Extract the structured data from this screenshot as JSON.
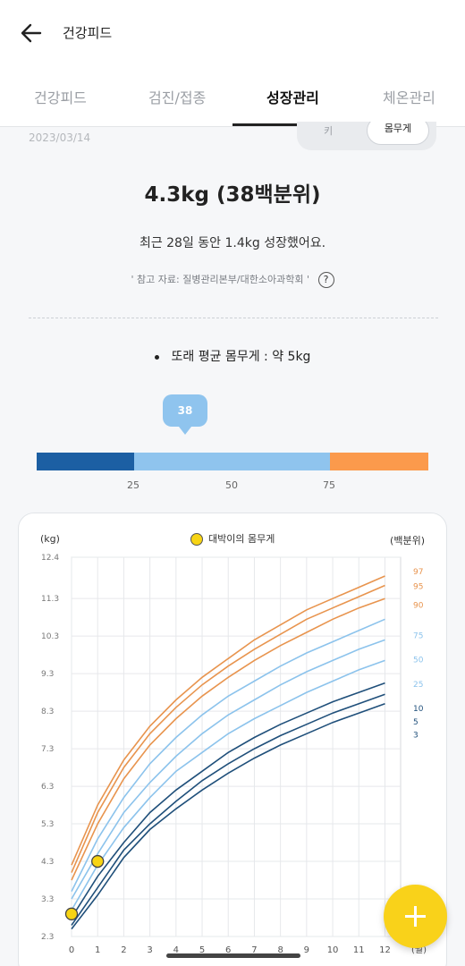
{
  "header": {
    "title": "건강피드",
    "back_icon": "arrow-left-icon"
  },
  "tabs": [
    {
      "label": "건강피드",
      "active": false
    },
    {
      "label": "검진/접종",
      "active": false
    },
    {
      "label": "성장관리",
      "active": true
    },
    {
      "label": "체온관리",
      "active": false
    }
  ],
  "date": "2023/03/14",
  "toggle": {
    "left": "키",
    "right": "몸무게",
    "selected": "몸무게"
  },
  "summary": {
    "headline": "4.3kg (38백분위)",
    "subtitle": "최근 28일 동안 1.4kg 성장했어요.",
    "reference": "' 참고 자료: 질병관리본부/대한소아과학회 '",
    "help_icon": "question-circle-icon",
    "help": "?",
    "peer_average": "또래 평균 몸무게 : 약 5kg"
  },
  "percentile": {
    "value": 38,
    "bubble": "38",
    "ticks": [
      "25",
      "50",
      "75"
    ],
    "colors": {
      "low": "#1c5fa3",
      "mid": "#8fc4ee",
      "high": "#fb9a4c"
    }
  },
  "chart_data": {
    "type": "line",
    "y_unit_label": "(kg)",
    "percentile_unit_label": "(백분위)",
    "legend": "대박이의 몸무게",
    "x_ticks": [
      "0",
      "1",
      "2",
      "3",
      "4",
      "5",
      "6",
      "7",
      "8",
      "9",
      "10",
      "11",
      "12"
    ],
    "x_unit_label": "(월)",
    "y_ticks": [
      "2.3",
      "3.3",
      "4.3",
      "5.3",
      "6.3",
      "7.3",
      "8.3",
      "9.3",
      "10.3",
      "11.3",
      "12.4"
    ],
    "ylim": [
      2.3,
      12.4
    ],
    "xlim": [
      0,
      12.6
    ],
    "months": [
      0,
      1,
      2,
      3,
      4,
      5,
      6,
      7,
      8,
      9,
      10,
      11,
      12
    ],
    "series": [
      {
        "name": "97",
        "color": "#e8944e",
        "values": [
          4.2,
          5.8,
          7.0,
          7.9,
          8.6,
          9.2,
          9.7,
          10.2,
          10.6,
          11.0,
          11.3,
          11.6,
          11.9
        ]
      },
      {
        "name": "95",
        "color": "#e8944e",
        "values": [
          4.0,
          5.6,
          6.8,
          7.7,
          8.4,
          9.0,
          9.5,
          9.95,
          10.35,
          10.75,
          11.05,
          11.35,
          11.65
        ]
      },
      {
        "name": "90",
        "color": "#e8944e",
        "values": [
          3.8,
          5.3,
          6.5,
          7.4,
          8.1,
          8.7,
          9.2,
          9.65,
          10.05,
          10.4,
          10.75,
          11.05,
          11.3
        ]
      },
      {
        "name": "75",
        "color": "#8cc3ec",
        "values": [
          3.5,
          4.9,
          6.0,
          6.9,
          7.6,
          8.2,
          8.7,
          9.1,
          9.5,
          9.85,
          10.15,
          10.45,
          10.75
        ]
      },
      {
        "name": "50",
        "color": "#8cc3ec",
        "values": [
          3.3,
          4.5,
          5.6,
          6.4,
          7.1,
          7.7,
          8.2,
          8.6,
          9.0,
          9.35,
          9.65,
          9.95,
          10.2
        ]
      },
      {
        "name": "25",
        "color": "#8cc3ec",
        "values": [
          3.0,
          4.2,
          5.2,
          6.0,
          6.7,
          7.2,
          7.7,
          8.1,
          8.45,
          8.8,
          9.1,
          9.4,
          9.65
        ]
      },
      {
        "name": "10",
        "color": "#1f4f7a",
        "values": [
          2.8,
          3.9,
          4.8,
          5.6,
          6.2,
          6.7,
          7.2,
          7.6,
          7.95,
          8.25,
          8.55,
          8.8,
          9.05
        ]
      },
      {
        "name": "5",
        "color": "#1f4f7a",
        "values": [
          2.6,
          3.6,
          4.6,
          5.3,
          5.9,
          6.45,
          6.9,
          7.3,
          7.65,
          7.95,
          8.25,
          8.5,
          8.75
        ]
      },
      {
        "name": "3",
        "color": "#1f4f7a",
        "values": [
          2.5,
          3.4,
          4.4,
          5.15,
          5.7,
          6.2,
          6.65,
          7.05,
          7.4,
          7.7,
          8.0,
          8.25,
          8.5
        ]
      }
    ],
    "baby": {
      "name": "대박이의 몸무게",
      "color": "#f7d414",
      "x": [
        0,
        1
      ],
      "y": [
        2.9,
        4.3
      ]
    }
  },
  "fab": {
    "icon": "plus-icon"
  }
}
